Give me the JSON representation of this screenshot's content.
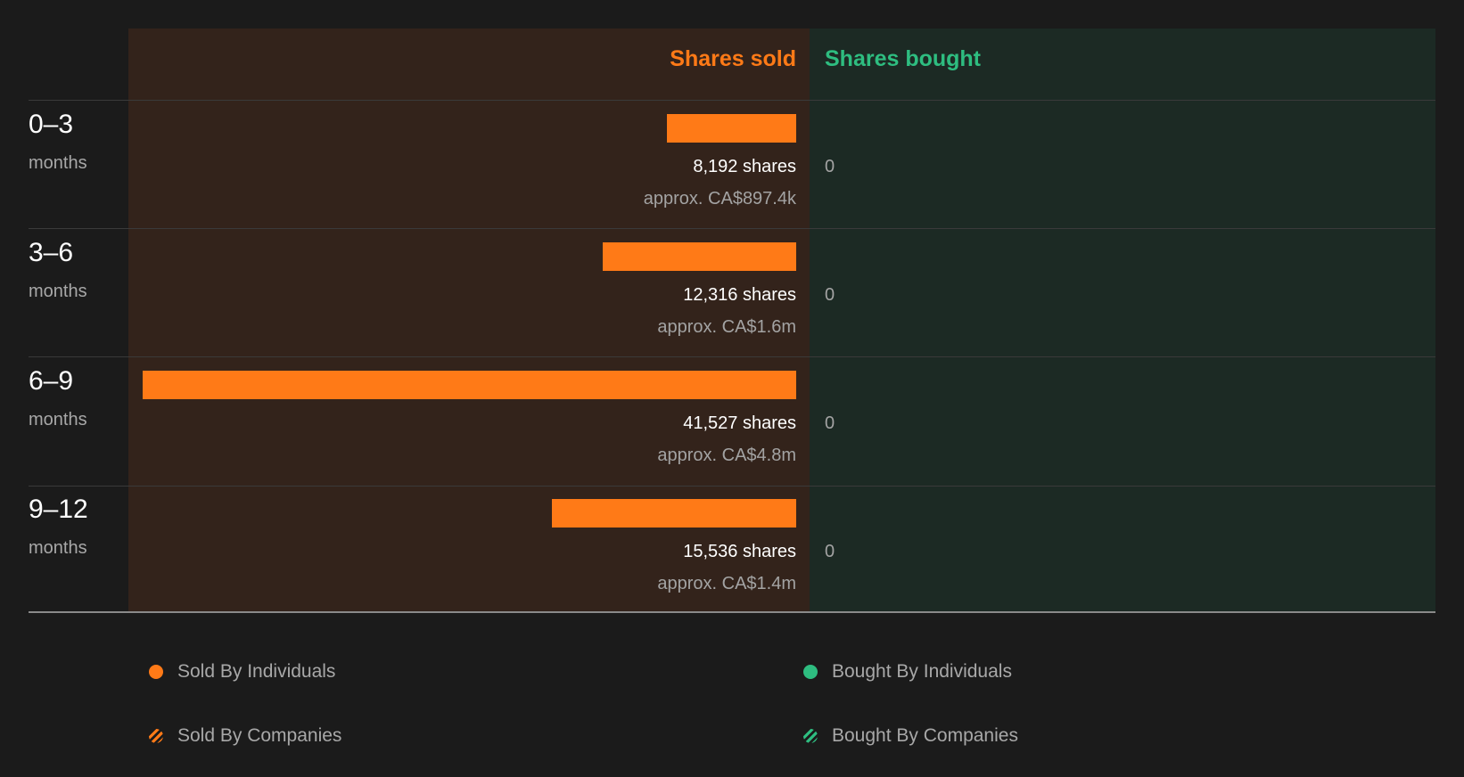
{
  "chart_data": {
    "type": "bar",
    "orientation": "horizontal-diverging",
    "columns": {
      "sold_label": "Shares sold",
      "bought_label": "Shares bought"
    },
    "unit_label": "months",
    "categories": [
      "0–3",
      "3–6",
      "6–9",
      "9–12"
    ],
    "series": [
      {
        "name": "Shares sold",
        "values": [
          8192,
          12316,
          41527,
          15536
        ],
        "value_labels": [
          "8,192 shares",
          "12,316 shares",
          "41,527 shares",
          "15,536 shares"
        ],
        "approx_labels": [
          "approx. CA$897.4k",
          "approx. CA$1.6m",
          "approx. CA$4.8m",
          "approx. CA$1.4m"
        ],
        "color": "#ff7a17"
      },
      {
        "name": "Shares bought",
        "values": [
          0,
          0,
          0,
          0
        ],
        "value_labels": [
          "0",
          "0",
          "0",
          "0"
        ],
        "color": "#2ebd80"
      }
    ],
    "xlim": [
      0,
      41527
    ],
    "grid": false,
    "legend": {
      "placement": "bottom",
      "items": [
        {
          "label": "Sold By Individuals",
          "color": "#ff7a17",
          "style": "solid"
        },
        {
          "label": "Bought By Individuals",
          "color": "#2ebd80",
          "style": "solid"
        },
        {
          "label": "Sold By Companies",
          "color": "#ff7a17",
          "style": "hatched"
        },
        {
          "label": "Bought By Companies",
          "color": "#2ebd80",
          "style": "hatched"
        }
      ]
    }
  }
}
